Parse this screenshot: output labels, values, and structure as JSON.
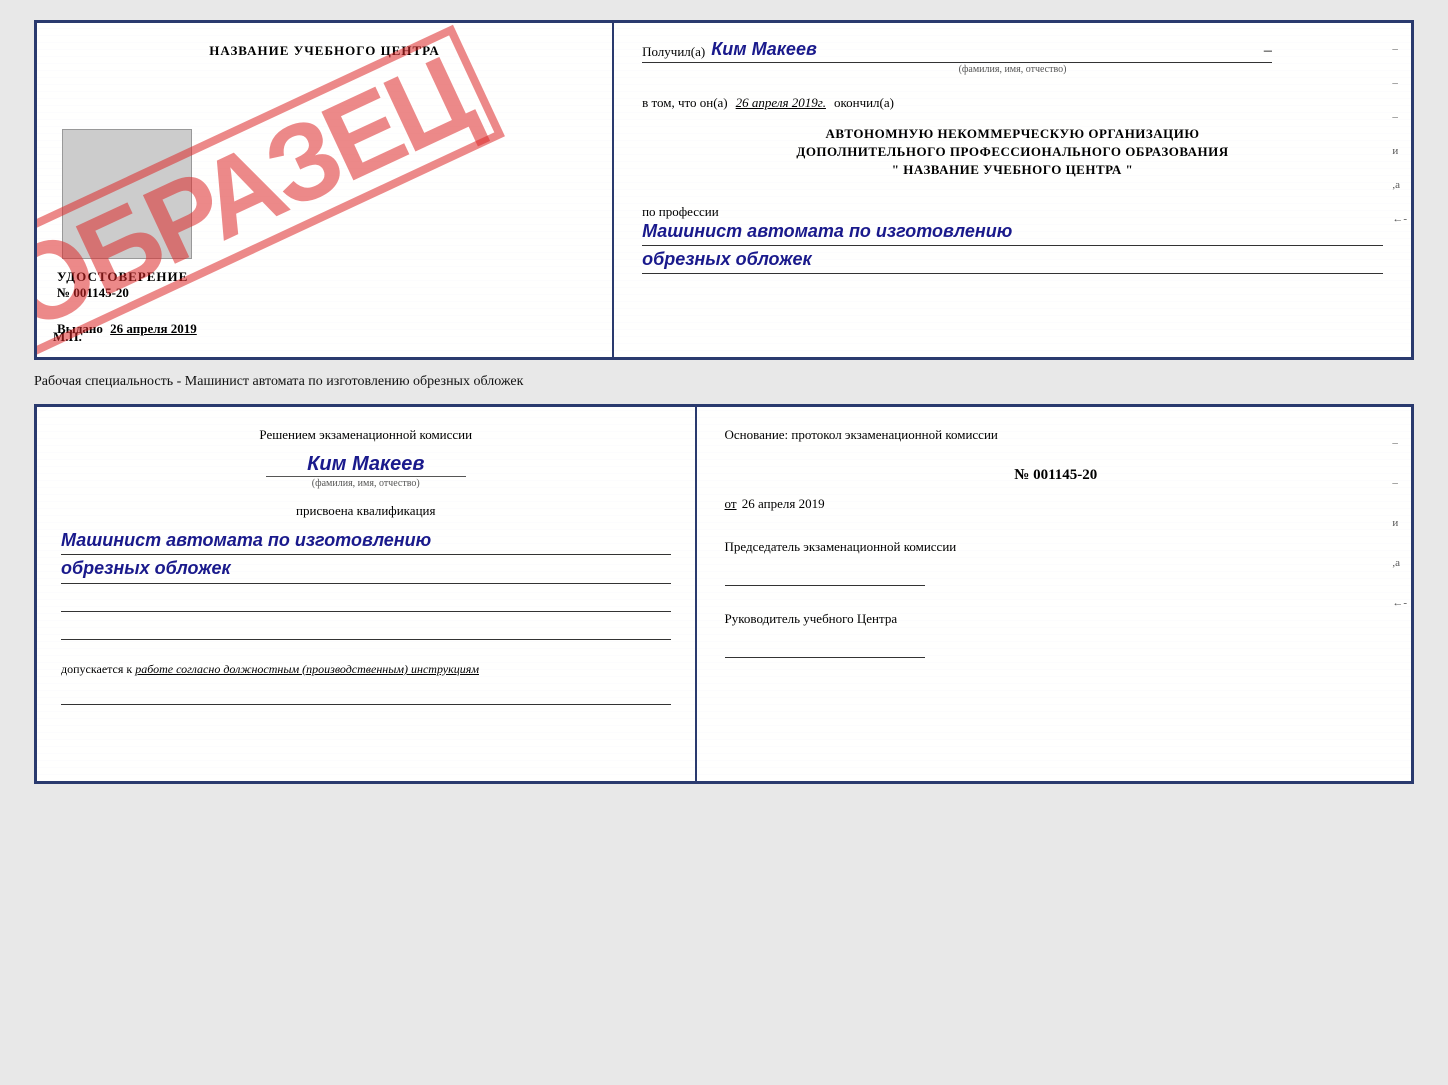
{
  "top_cert": {
    "left": {
      "school_name": "НАЗВАНИЕ УЧЕБНОГО ЦЕНТРА",
      "stamp_label": "ОБРАЗЕЦ",
      "udost_title": "УДОСТОВЕРЕНИЕ",
      "udost_number": "№ 001145-20",
      "vydano_label": "Выдано",
      "vydano_date": "26 апреля 2019",
      "mp_label": "М.П."
    },
    "right": {
      "recipient_label": "Получил(а)",
      "recipient_name": "Ким Макеев",
      "fio_hint": "(фамилия, имя, отчество)",
      "vtom_label": "в том, что он(а)",
      "vtom_date": "26 апреля 2019г.",
      "okonchil_label": "окончил(а)",
      "org_line1": "АВТОНОМНУЮ НЕКОММЕРЧЕСКУЮ ОРГАНИЗАЦИЮ",
      "org_line2": "ДОПОЛНИТЕЛЬНОГО ПРОФЕССИОНАЛЬНОГО ОБРАЗОВАНИЯ",
      "org_line3": "\"  НАЗВАНИЕ УЧЕБНОГО ЦЕНТРА  \"",
      "profession_label": "по профессии",
      "profession_value1": "Машинист автомата по изготовлению",
      "profession_value2": "обрезных обложек",
      "dash1": "–",
      "dash2": "–",
      "dash3": "–",
      "mark_i": "и",
      "mark_a": ",а",
      "mark_arrow": "←-"
    }
  },
  "caption": {
    "text": "Рабочая специальность - Машинист автомата по изготовлению обрезных обложек"
  },
  "bottom_cert": {
    "left": {
      "decision_line1": "Решением экзаменационной комиссии",
      "komissia_name": "Ким Макеев",
      "fio_hint": "(фамилия, имя, отчество)",
      "prisvoena_label": "присвоена квалификация",
      "profession_value1": "Машинист автомата по изготовлению",
      "profession_value2": "обрезных обложек",
      "dopusk_label": "допускается к",
      "dopusk_text": "работе согласно должностным (производственным) инструкциям"
    },
    "right": {
      "osnovanie_label": "Основание: протокол экзаменационной комиссии",
      "protocol_number": "№  001145-20",
      "protocol_date_prefix": "от",
      "protocol_date": "26 апреля 2019",
      "predsedatel_label": "Председатель экзаменационной комиссии",
      "rukovoditel_label": "Руководитель учебного Центра",
      "dash1": "–",
      "dash2": "–",
      "mark_i": "и",
      "mark_a": ",а",
      "mark_arrow": "←-"
    }
  }
}
